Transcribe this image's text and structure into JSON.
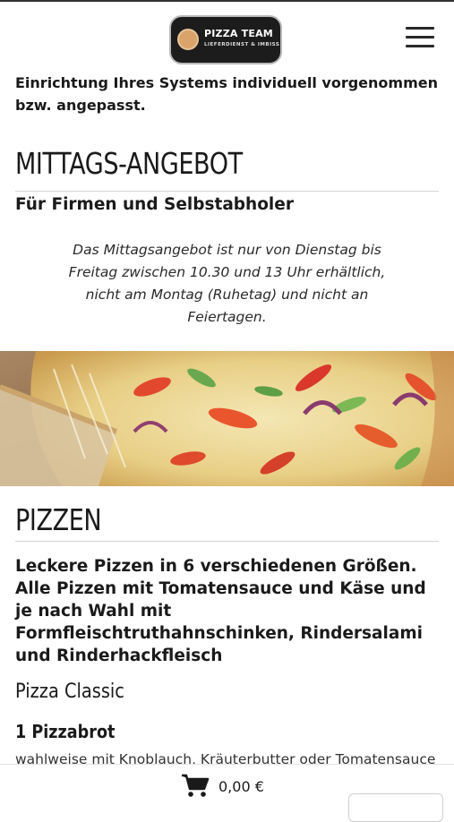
{
  "header": {
    "logo_title": "PIZZA TEAM",
    "logo_subtitle": "LIEFERDIENST & IMBISS",
    "menu_icon": "hamburger-menu-icon"
  },
  "intro": {
    "text": "Einrichtung Ihres Systems individuell vorgenommen bzw. angepasst."
  },
  "lunch": {
    "heading": "MITTAGS-ANGEBOT",
    "subheading": "Für Firmen und Selbstabholer",
    "note": "Das Mittagsangebot ist nur von Dienstag bis Freitag zwischen 10.30 und 13 Uhr erhältlich, nicht am Montag (Ruhetag) und nicht an Feiertagen."
  },
  "pizzen": {
    "heading": "PIZZEN",
    "description": "Leckere Pizzen in 6 verschiedenen Größen. Alle Pizzen mit Tomatensauce und Käse und je nach Wahl mit Formfleischtruthahnschinken, Rindersalami und Rinderhackfleisch",
    "category": "Pizza Classic",
    "product": {
      "title": "1 Pizzabrot",
      "description": "wahlweise mit Knoblauch, Kräuterbutter oder Tomatensauce"
    }
  },
  "cart": {
    "icon": "cart-icon",
    "total": "0,00 €"
  },
  "colors": {
    "logo_bg": "#1c1c1c",
    "logo_accent": "#d9a36a",
    "text": "#1a1a1a",
    "rule": "#d6d6d6"
  }
}
